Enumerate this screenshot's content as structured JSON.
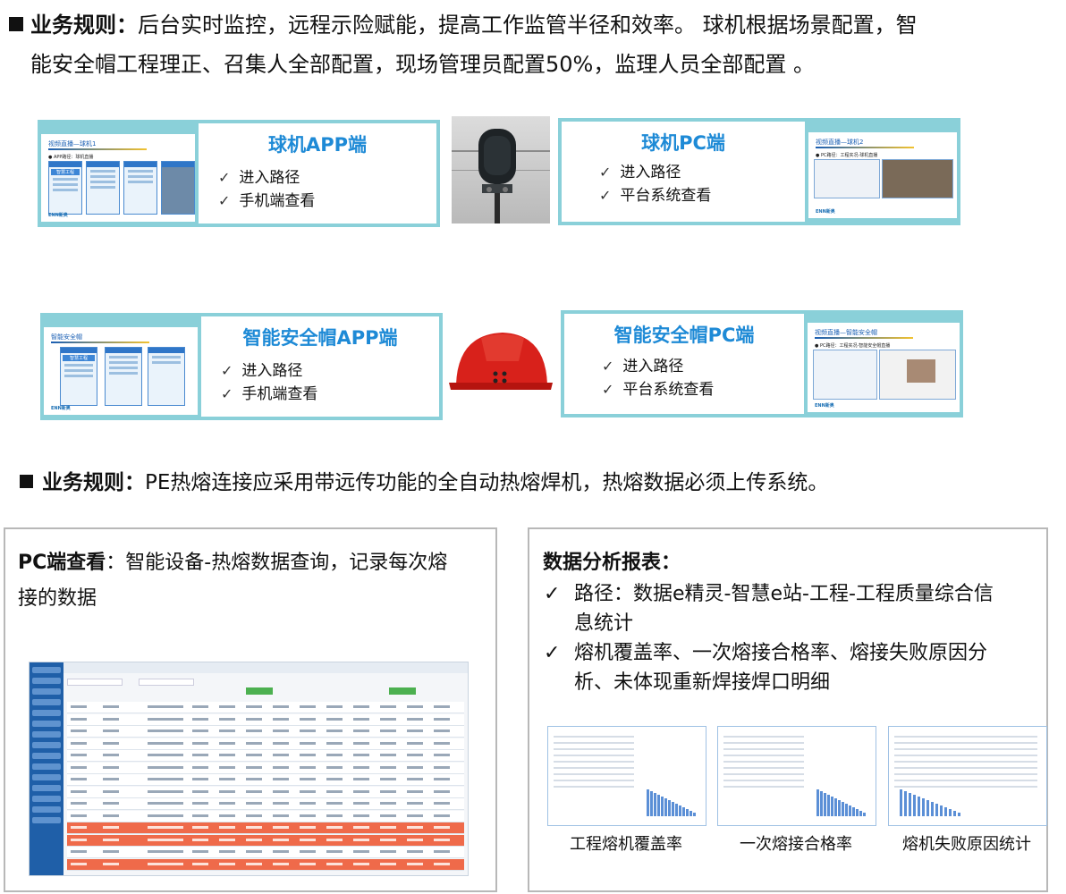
{
  "rule1": {
    "label": "业务规则：",
    "line1": "后台实时监控，远程示险赋能，提高工作监管半径和效率。 球机根据场景配置，智",
    "line2": "能安全帽工程理正、召集人全部配置，现场管理员配置50%，监理人员全部配置 。"
  },
  "cards": {
    "ball_app": {
      "title": "球机APP端",
      "items": [
        "进入路径",
        "手机端查看"
      ],
      "slide_title": "视频直播—球机1",
      "slide_sub": "● APP路径：球机直播",
      "slide_banner": "智慧工程",
      "slide_logo": "ENN新奥"
    },
    "ball_pc": {
      "title": "球机PC端",
      "items": [
        "进入路径",
        "平台系统查看"
      ],
      "slide_title": "视频直播—球机2",
      "slide_sub": "● PC路径：工程实况-球机直播",
      "slide_logo": "ENN新奥"
    },
    "helmet_app": {
      "title": "智能安全帽APP端",
      "items": [
        "进入路径",
        "手机端查看"
      ],
      "slide_title": "智能安全帽",
      "slide_banner": "智慧工程",
      "slide_logo": "ENN新奥"
    },
    "helmet_pc": {
      "title": "智能安全帽PC端",
      "items": [
        "进入路径",
        "平台系统查看"
      ],
      "slide_title": "视频直播—智能安全帽",
      "slide_sub": "● PC路径：工程实况-智能安全帽直播",
      "slide_logo": "ENN新奥"
    }
  },
  "check_mark": "✓",
  "rule2": {
    "label": "业务规则",
    "colon": "：",
    "text": "PE热熔连接应采用带远传功能的全自动热熔焊机，热熔数据必须上传系统。"
  },
  "pc_panel": {
    "label": "PC端查看",
    "text_line1": "：智能设备-热熔数据查询，记录每次熔",
    "text_line2": "接的数据"
  },
  "analysis_panel": {
    "title": "数据分析报表：",
    "items": [
      [
        "路径：数据e精灵-智慧e站-工程-工程质量综合信",
        "息统计"
      ],
      [
        "熔机覆盖率、一次熔接合格率、熔接失败原因分",
        "析、未体现重新焊接焊口明细"
      ]
    ],
    "captions": [
      "工程熔机覆盖率",
      "一次熔接合格率",
      "熔机失败原因统计"
    ]
  }
}
